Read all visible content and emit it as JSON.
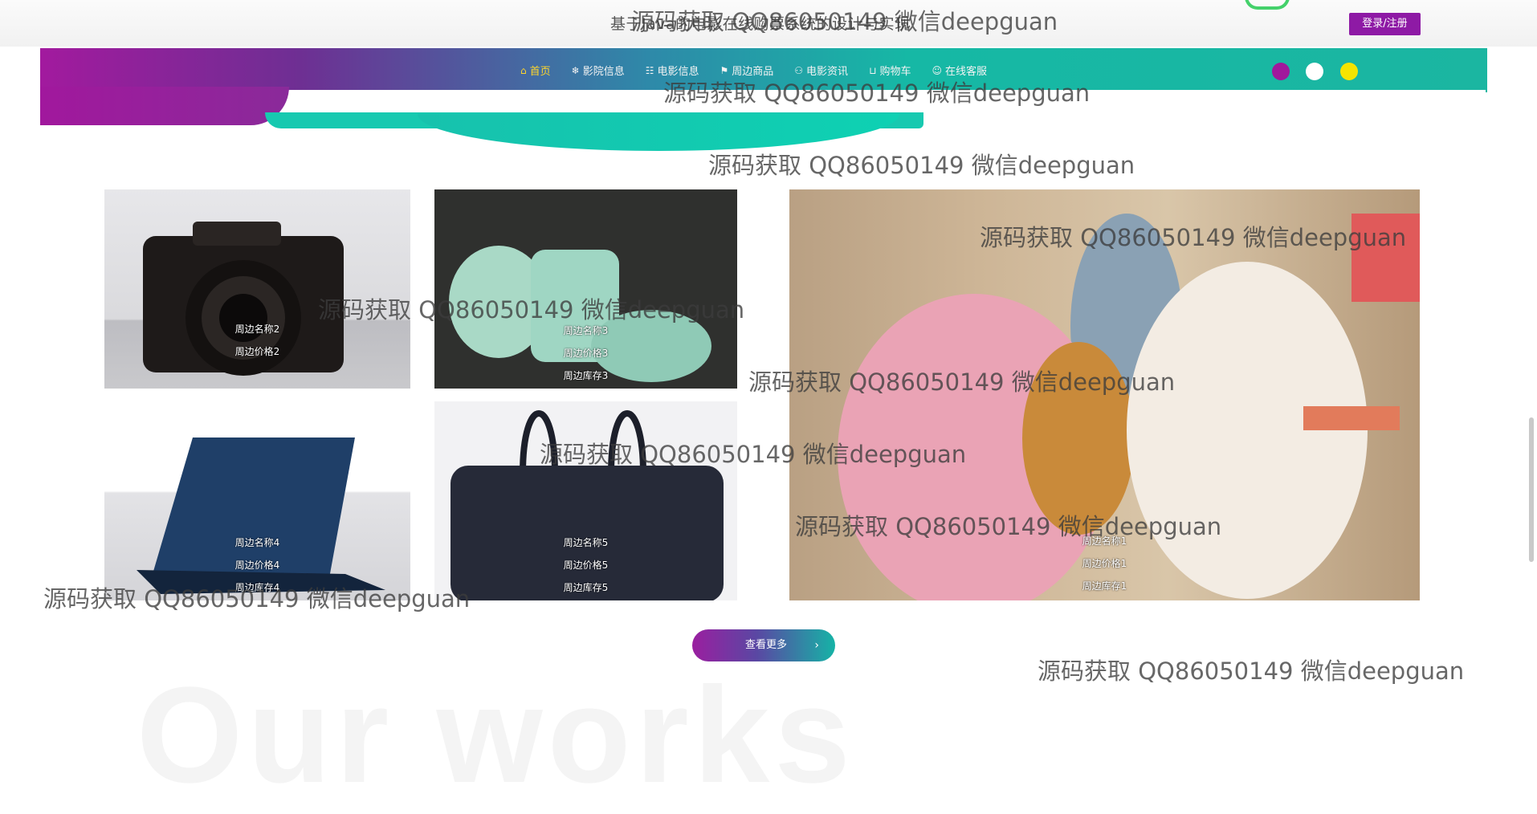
{
  "header": {
    "site_title": "基于Java的电影在线购票系统的设计与实现",
    "login_label": "登录/注册"
  },
  "nav": {
    "items": [
      {
        "label": "首页",
        "icon": "home-icon",
        "glyph": "⌂",
        "active": true
      },
      {
        "label": "影院信息",
        "icon": "snowflake-icon",
        "glyph": "❄"
      },
      {
        "label": "电影信息",
        "icon": "film-icon",
        "glyph": "☷"
      },
      {
        "label": "周边商品",
        "icon": "flag-icon",
        "glyph": "⚑"
      },
      {
        "label": "电影资讯",
        "icon": "news-icon",
        "glyph": "⚇"
      },
      {
        "label": "购物车",
        "icon": "cart-icon",
        "glyph": "⊔"
      },
      {
        "label": "在线客服",
        "icon": "chat-icon",
        "glyph": "☺"
      }
    ],
    "theme_dots": [
      "#a0189c",
      "#ffffff",
      "#f5e400"
    ]
  },
  "gallery": {
    "items": [
      {
        "name": "周边名称2",
        "line2": "周边价格2",
        "line3": ""
      },
      {
        "name": "周边名称3",
        "line2": "周边价格3",
        "line3": "周边库存3"
      },
      {
        "name": "周边名称1",
        "line2": "周边价格1",
        "line3": "周边库存1"
      },
      {
        "name": "周边名称4",
        "line2": "周边价格4",
        "line3": "周边库存4"
      },
      {
        "name": "周边名称5",
        "line2": "周边价格5",
        "line3": "周边库存5"
      }
    ]
  },
  "more_label": "查看更多",
  "section_bg_text": "Our works",
  "watermark_text": "源码获取 QQ86050149 微信deepguan"
}
